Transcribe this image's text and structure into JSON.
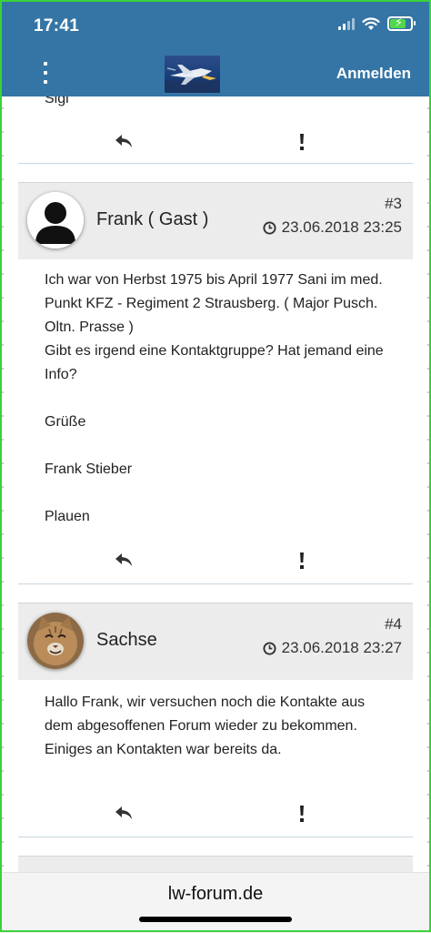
{
  "status_bar": {
    "time": "17:41"
  },
  "header": {
    "login_label": "Anmelden"
  },
  "previous_post": {
    "signature_fragment": "Sigi"
  },
  "posts": [
    {
      "number": "#3",
      "author": "Frank ( Gast )",
      "date": "23.06.2018 23:25",
      "avatar": "guest-silhouette",
      "body": [
        "Ich war von Herbst 1975 bis April 1977 Sani im med. Punkt KFZ - Regiment 2 Strausberg. ( Major Pusch. Oltn. Prasse )",
        "Gibt es irgend eine Kontaktgruppe? Hat jemand eine Info?",
        "Grüße",
        "Frank Stieber",
        "Plauen"
      ]
    },
    {
      "number": "#4",
      "author": "Sachse",
      "date": "23.06.2018 23:27",
      "avatar": "cat-photo",
      "body": [
        "Hallo Frank, wir versuchen noch die Kontakte aus dem abgesoffenen Forum wieder zu bekommen. Einiges an Kontakten war bereits da."
      ]
    }
  ],
  "browser": {
    "url": "lw-forum.de"
  },
  "icons": {
    "menu": "vertical-dots-icon",
    "reply": "reply-arrow-icon",
    "report": "exclamation-icon",
    "clock": "clock-icon"
  },
  "colors": {
    "header_bg": "#3575a5",
    "post_header_bg": "#ececec",
    "frame": "#3ad13a"
  }
}
